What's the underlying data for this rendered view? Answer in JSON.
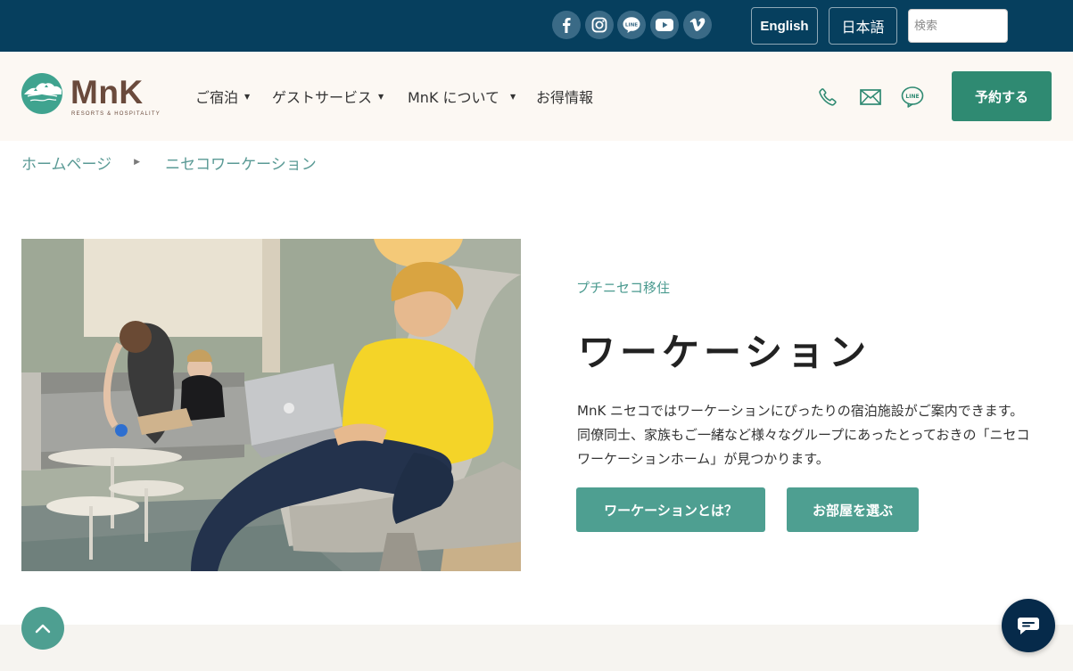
{
  "topbar": {
    "social": [
      {
        "icon": "facebook-icon"
      },
      {
        "icon": "instagram-icon"
      },
      {
        "icon": "line-icon",
        "label": "LINE"
      },
      {
        "icon": "youtube-icon"
      },
      {
        "icon": "vimeo-icon"
      }
    ],
    "lang_en": "English",
    "lang_ja": "日本語",
    "search_placeholder": "検索"
  },
  "header": {
    "logo_text": "MnK",
    "logo_sub": "RESORTS & HOSPITALITY",
    "nav": [
      {
        "label": "ご宿泊",
        "dropdown": true
      },
      {
        "label": "ゲストサービス",
        "dropdown": true
      },
      {
        "label": "MnK について",
        "dropdown": true
      },
      {
        "label": "お得情報",
        "dropdown": false
      }
    ],
    "caret": "▼",
    "line_label": "LINE",
    "reserve_label": "予約する"
  },
  "breadcrumb": {
    "home": "ホームページ",
    "separator": "▶",
    "current": "ニセコワーケーション"
  },
  "main": {
    "eyebrow": "プチニセコ移住",
    "title": "ワーケーション",
    "description": "MnK ニセコではワーケーションにぴったりの宿泊施設がご案内できます。同僚同士、家族もご一緒など様々なグループにあったとっておきの「ニセコワーケーションホーム」が見つかります。",
    "buttons": [
      "ワーケーションとは？",
      "お部屋を選ぶ"
    ]
  },
  "colors": {
    "topbar": "#063f5e",
    "header_bg": "#fcf8f3",
    "accent_green": "#2f8a72",
    "teal": "#4e9f91",
    "chat": "#062a4a"
  }
}
